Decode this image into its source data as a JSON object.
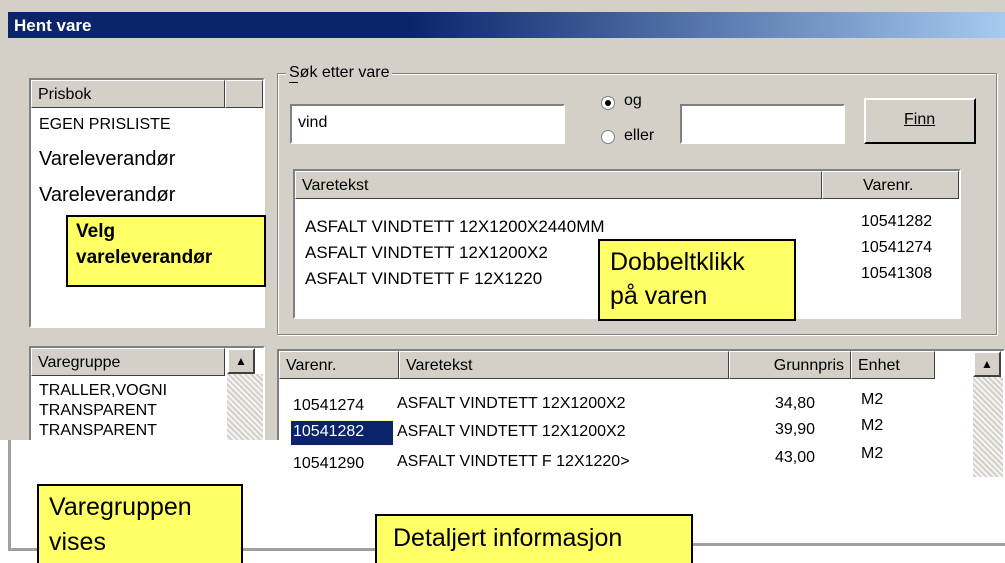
{
  "window": {
    "title": "Hent vare"
  },
  "prisbok": {
    "header": "Prisbok",
    "items": [
      "EGEN PRISLISTE",
      "Vareleverandør",
      "Vareleverandør"
    ]
  },
  "search": {
    "group_label": "Søk etter vare",
    "query": "vind",
    "radio_og": "og",
    "radio_eller": "eller",
    "second_query": "",
    "find_button": "Finn"
  },
  "results": {
    "headers": [
      "Varetekst",
      "Varenr."
    ],
    "rows": [
      {
        "text": "ASFALT VINDTETT 12X1200X2440MM",
        "nr": "10541282"
      },
      {
        "text": "ASFALT VINDTETT 12X1200X2",
        "nr": "10541274"
      },
      {
        "text": "ASFALT VINDTETT F 12X1220",
        "nr": "10541308"
      }
    ]
  },
  "varegruppe": {
    "header": "Varegruppe",
    "items": [
      "TRALLER,VOGNI",
      "TRANSPARENT",
      "TRANSPARENT"
    ]
  },
  "details": {
    "headers": [
      "Varenr.",
      "Varetekst",
      "Grunnpris",
      "Enhet"
    ],
    "rows": [
      {
        "nr": "10541274",
        "text": "ASFALT VINDTETT 12X1200X2",
        "price": "34,80",
        "unit": "M2"
      },
      {
        "nr": "10541282",
        "text": "ASFALT VINDTETT 12X1200X2",
        "price": "39,90",
        "unit": "M2"
      },
      {
        "nr": "10541290",
        "text": "ASFALT VINDTETT F 12X1220>",
        "price": "43,00",
        "unit": "M2"
      }
    ]
  },
  "callouts": {
    "velg": "Velg vareleverandør",
    "velg_line1": "Velg",
    "velg_line2": "vareleverandør",
    "dobbelt_line1": "Dobbeltklikk",
    "dobbelt_line2": "på varen",
    "varegruppen_line1": "Varegruppen",
    "varegruppen_line2": "vises",
    "detaljert": "Detaljert informasjon"
  },
  "colors": {
    "title_bar": "#0a246a",
    "selection": "#0a246a",
    "callout": "#ffff66",
    "dialog": "#d4d0c8"
  }
}
